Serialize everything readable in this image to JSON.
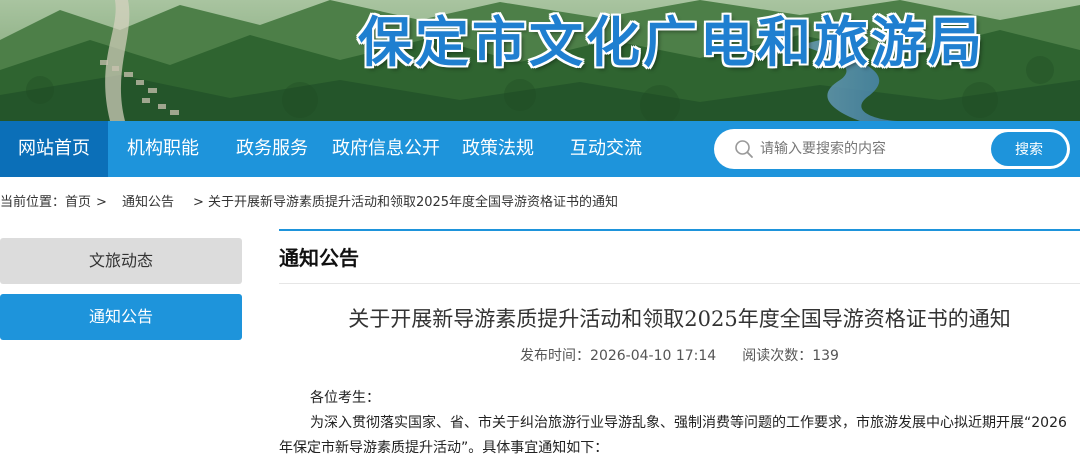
{
  "banner": {
    "title": "保定市文化广电和旅游局",
    "image_desc": "mountain-river-landscape"
  },
  "nav": {
    "items": [
      {
        "label": "网站首页",
        "active": true
      },
      {
        "label": "机构职能",
        "active": false
      },
      {
        "label": "政务服务",
        "active": false
      },
      {
        "label": "政府信息公开",
        "active": false
      },
      {
        "label": "政策法规",
        "active": false
      },
      {
        "label": "互动交流",
        "active": false
      }
    ]
  },
  "search": {
    "placeholder": "请输入要搜索的内容",
    "button_label": "搜索",
    "icon": "search-icon"
  },
  "breadcrumb": {
    "prefix": "当前位置：",
    "home": "首页",
    "sep": ">",
    "section": "通知公告",
    "current": "> 关于开展新导游素质提升活动和领取2025年度全国导游资格证书的通知"
  },
  "sidebar": {
    "items": [
      {
        "label": "文旅动态",
        "active": false
      },
      {
        "label": "通知公告",
        "active": true
      }
    ]
  },
  "main": {
    "section_title": "通知公告",
    "article": {
      "title": "关于开展新导游素质提升活动和领取2025年度全国导游资格证书的通知",
      "publish_label": "发布时间：",
      "publish_time": "2026-04-10 17:14",
      "views_label": "阅读次数：",
      "views": "139",
      "greeting": "各位考生：",
      "paragraph": "为深入贯彻落实国家、省、市关于纠治旅游行业导游乱象、强制消费等问题的工作要求，市旅游发展中心拟近期开展“2026年保定市新导游素质提升活动”。具体事宜通知如下："
    }
  },
  "colors": {
    "nav_bg": "#1e94db",
    "nav_active": "#0b6fb8",
    "accent": "#1e94db",
    "banner_title": "#1f7fd0"
  }
}
